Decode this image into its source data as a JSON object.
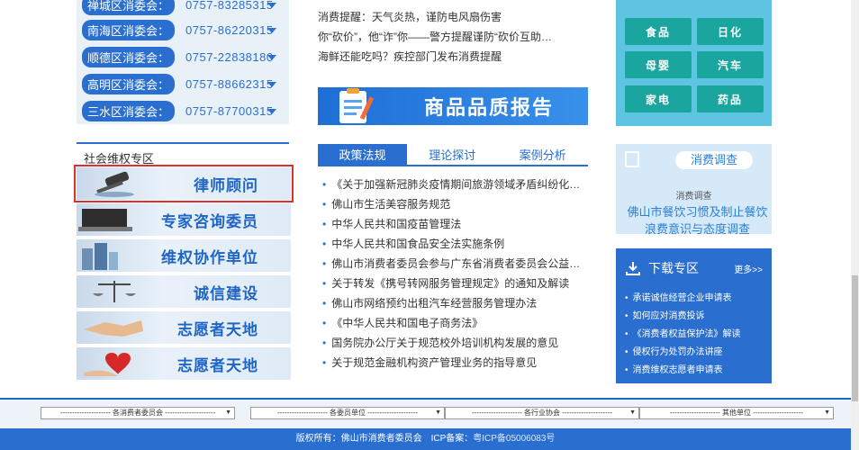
{
  "hotlines": [
    {
      "name": "禅城区消委会：",
      "tel": "0757-83285315"
    },
    {
      "name": "南海区消委会：",
      "tel": "0757-86220315"
    },
    {
      "name": "顺德区消委会：",
      "tel": "0757-22838180"
    },
    {
      "name": "高明区消委会：",
      "tel": "0757-88662315"
    },
    {
      "name": "三水区消委会：",
      "tel": "0757-87700315"
    }
  ],
  "rights": {
    "heading": "社会维权专区",
    "items": [
      "律师顾问",
      "专家咨询委员",
      "维权协作单位",
      "诚信建设",
      "志愿者天地",
      "志愿者天地"
    ]
  },
  "news": [
    "消费提醒：天气炎热，谨防电风扇伤害",
    "你“砍价”，他“诈”你——警方提醒谨防“砍价互助…",
    "海鲜还能吃吗？疾控部门发布消费提醒"
  ],
  "quality_banner": "商品品质报告",
  "tabs": [
    "政策法规",
    "理论探讨",
    "案例分析"
  ],
  "policy": [
    "《关于加强新冠肺炎疫情期间旅游领域矛盾纠纷化…",
    "佛山市生活美容服务规范",
    "中华人民共和国疫苗管理法",
    "中华人民共和国食品安全法实施条例",
    "佛山市消费者委员会参与广东省消费者委员会公益…",
    "关于转发《携号转网服务管理规定》的通知及解读",
    "佛山市网络预约出租汽车经营服务管理办法",
    "《中华人民共和国电子商务法》",
    "国务院办公厅关于规范校外培训机构发展的意见",
    "关于规范金融机构资产管理业务的指导意见"
  ],
  "categories": [
    "食品",
    "日化",
    "母婴",
    "汽车",
    "家电",
    "药品"
  ],
  "survey": {
    "label": "消费调查",
    "sub": "消费调查",
    "title": "佛山市餐饮习惯及制止餐饮浪费意识与态度调查"
  },
  "download": {
    "title": "下载专区",
    "more": "更多>>",
    "items": [
      "承诺诚信经营企业申请表",
      "如何应对消费投诉",
      "《消费者权益保护法》解读",
      "侵权行为处罚办法讲座",
      "消费维权志愿者申请表"
    ]
  },
  "footer": {
    "selects": [
      "--------------------- 各消费者委员会 ---------------------",
      "--------------------- 各委员单位 ---------------------",
      "--------------------- 各行业协会 ---------------------",
      "--------------------- 其他单位 ---------------------"
    ],
    "copyright_prefix": "版权所有：佛山市消费者委员会　ICP备案：",
    "icp": "粤ICP备05006083号"
  },
  "colors": {
    "primary": "#2a6fd0",
    "teal": "#1aa59e",
    "cyan": "#5ec4e2",
    "highlight": "#d93030"
  }
}
